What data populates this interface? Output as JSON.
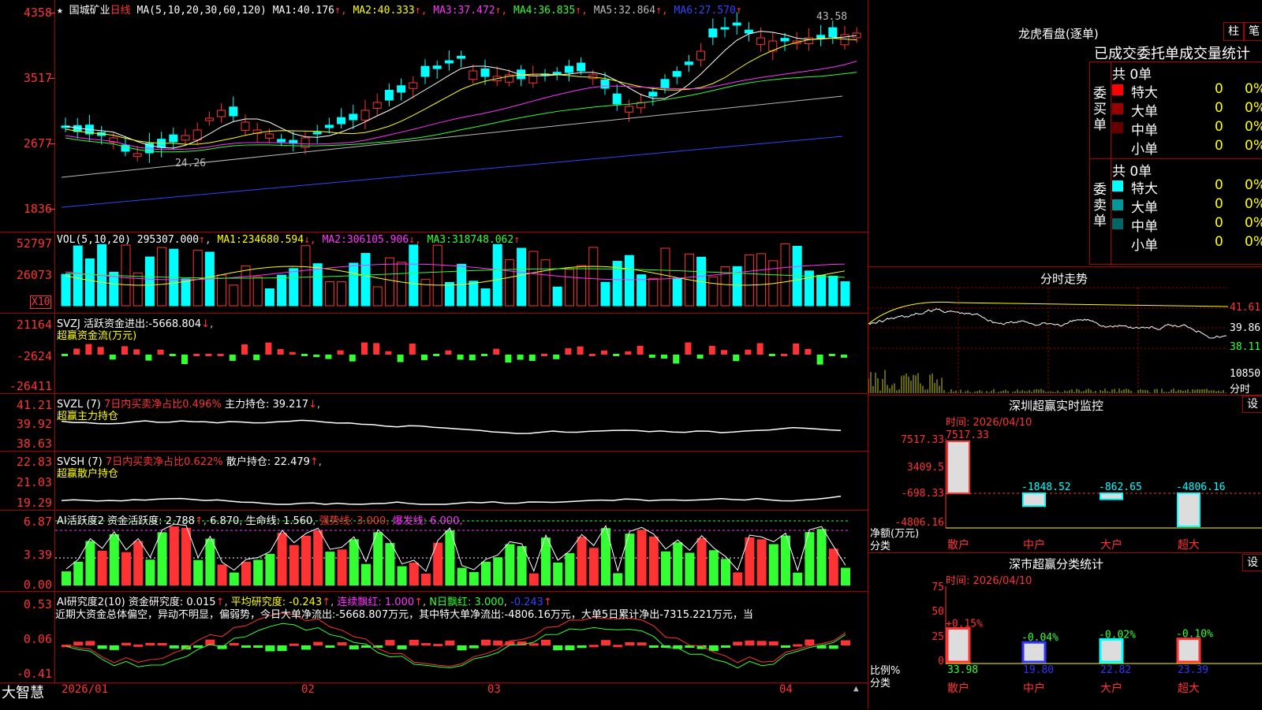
{
  "stock": {
    "star": "★",
    "name": "国城矿业",
    "period": "日线",
    "ma_label": "MA(5,10,20,30,60,120)",
    "ma": [
      {
        "k": "MA1:",
        "v": "40.176",
        "arrow": "↑",
        "color": "#ffffff"
      },
      {
        "k": "MA2:",
        "v": "40.333",
        "arrow": "↑",
        "color": "#ffff00"
      },
      {
        "k": "MA3:",
        "v": "37.472",
        "arrow": "↑",
        "color": "#ff33ff"
      },
      {
        "k": "MA4:",
        "v": "36.835",
        "arrow": "↑",
        "color": "#33ff33"
      },
      {
        "k": "MA5:",
        "v": "32.864",
        "arrow": "↑",
        "color": "#bbbbbb"
      },
      {
        "k": "MA6:",
        "v": "27.570",
        "arrow": "↑",
        "color": "#3344ff"
      }
    ],
    "yticks": [
      "4358",
      "3517",
      "2677",
      "1836"
    ],
    "high_label": "43.58",
    "low_label": "24.26"
  },
  "vol": {
    "label": "VOL(5,10,20)",
    "value": "295307.000",
    "arrow": "↑",
    "ma": [
      {
        "k": "MA1:",
        "v": "234680.594",
        "arrow": "↓",
        "color": "#ffff00"
      },
      {
        "k": "MA2:",
        "v": "306105.906",
        "arrow": "↓",
        "color": "#ff33ff"
      },
      {
        "k": "MA3:",
        "v": "318748.062",
        "arrow": "↑",
        "color": "#33ff33"
      }
    ],
    "yticks": [
      "52797",
      "26073"
    ],
    "unit": "X10"
  },
  "svzj": {
    "label": "SVZJ",
    "t1": "活跃资金进出:",
    "v1": "-5668.804",
    "arrow": "↓",
    "t2": "超赢资金流(万元)",
    "yticks": [
      "21164",
      "-2624",
      "-26411"
    ]
  },
  "svzl": {
    "label": "SVZL (7)",
    "t1": "7日内买卖净占比0.496%",
    "t2": "主力持仓:",
    "v2": "39.217",
    "arrow": "↓",
    "t3": "超赢主力持仓",
    "yticks": [
      "41.21",
      "39.92",
      "38.63"
    ]
  },
  "svsh": {
    "label": "SVSH (7)",
    "t1": "7日内买卖净占比0.622%",
    "t2": "散户持仓:",
    "v2": "22.479",
    "arrow": "↑",
    "t3": "超赢散户持仓",
    "yticks": [
      "22.83",
      "21.03",
      "19.29"
    ]
  },
  "ai1": {
    "label": "AI活跃度2",
    "t1": "资金活跃度:",
    "v1": "2.788",
    "v2": "6.870",
    "t3": "生命线:",
    "v3": "1.560",
    "t4": "强势线:",
    "v4": "3.000",
    "t5": "爆发线:",
    "v5": "6.000",
    "yticks": [
      "6.87",
      "3.39",
      "0.00"
    ]
  },
  "ai2": {
    "label": "AI研究度2(10)",
    "t1": "资金研究度:",
    "v1": "0.015",
    "t2": "平均研究度:",
    "v2": "-0.243",
    "t3": "连续飘红:",
    "v3": "1.000",
    "t4": "N日飘红:",
    "v4": "3.000",
    "v5": "-0.243",
    "comment": "近期大资金总体偏空，异动不明显，偏弱势，今日大单净流出:-5668.807万元，其中特大单净流出:-4806.16万元，大单5日累计净出-7315.221万元，当",
    "yticks": [
      "0.53",
      "0.06",
      "-0.41"
    ]
  },
  "xaxis": {
    "labels": [
      "2026/01",
      "02",
      "03",
      "04"
    ],
    "brand": "大智慧"
  },
  "right": {
    "title": "龙虎看盘(逐单)",
    "btn1": "柱",
    "btn2": "笔",
    "header": "已成交委托单成交量统计",
    "buy": {
      "side": "委买单",
      "total": "共 0单",
      "rows": [
        {
          "label": "特大",
          "n": "0",
          "p": "0%",
          "color": "#ff0000"
        },
        {
          "label": "大单",
          "n": "0",
          "p": "0%",
          "color": "#990000"
        },
        {
          "label": "中单",
          "n": "0",
          "p": "0%",
          "color": "#660000"
        },
        {
          "label": "小单",
          "n": "0",
          "p": "0%",
          "color": ""
        }
      ]
    },
    "sell": {
      "side": "委卖单",
      "total": "共 0单",
      "rows": [
        {
          "label": "特大",
          "n": "0",
          "p": "0%",
          "color": "#00ffff"
        },
        {
          "label": "大单",
          "n": "0",
          "p": "0%",
          "color": "#009999"
        },
        {
          "label": "中单",
          "n": "0",
          "p": "0%",
          "color": "#006666"
        },
        {
          "label": "小单",
          "n": "0",
          "p": "0%",
          "color": ""
        }
      ]
    },
    "intraday": {
      "title": "分时走势",
      "p1": "41.61",
      "p2": "39.86",
      "p3": "38.11",
      "v1": "10850",
      "v2": "分时"
    },
    "monitor": {
      "title": "深圳超赢实时监控",
      "btn": "设",
      "time": "时间: 2026/04/10",
      "yticks": [
        "7517.33",
        "3409.5",
        "-698.33",
        "-4806.16"
      ],
      "bars": [
        {
          "cat": "散户",
          "value": "7517.33"
        },
        {
          "cat": "中户",
          "value": "-1848.52"
        },
        {
          "cat": "大户",
          "value": "-862.65"
        },
        {
          "cat": "超大",
          "value": "-4806.16"
        }
      ],
      "ylab": "净额(万元)",
      "xlab": "分类"
    },
    "classify": {
      "title": "深市超赢分类统计",
      "btn": "设",
      "time": "时间: 2026/04/10",
      "yticks": [
        "75",
        "50",
        "25",
        "0"
      ],
      "bars": [
        {
          "cat": "散户",
          "pct": "33.98",
          "chg": "+0.15%"
        },
        {
          "cat": "中户",
          "pct": "19.80",
          "chg": "-0.04%"
        },
        {
          "cat": "大户",
          "pct": "22.82",
          "chg": "-0.02%"
        },
        {
          "cat": "超大",
          "pct": "23.39",
          "chg": "-0.10%"
        }
      ],
      "ylab": "比例%",
      "xlab": "分类"
    }
  }
}
